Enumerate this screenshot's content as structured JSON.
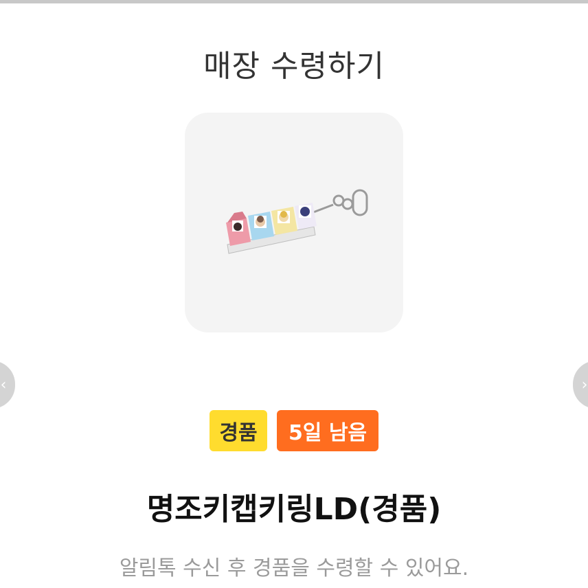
{
  "header": {
    "title": "매장 수령하기"
  },
  "product": {
    "image_icon": "keycap-keyring-image",
    "name": "명조키캡키링LD(경품)"
  },
  "badges": {
    "gift_label": "경품",
    "remaining_label": "5일 남음",
    "gift_color": "#ffdc2e",
    "remaining_color": "#ff6d1f"
  },
  "notice": {
    "text": "알림톡 수신 후 경품을 수령할 수 있어요."
  },
  "navigation": {
    "prev_icon": "chevron-left-icon",
    "next_icon": "chevron-right-icon"
  }
}
